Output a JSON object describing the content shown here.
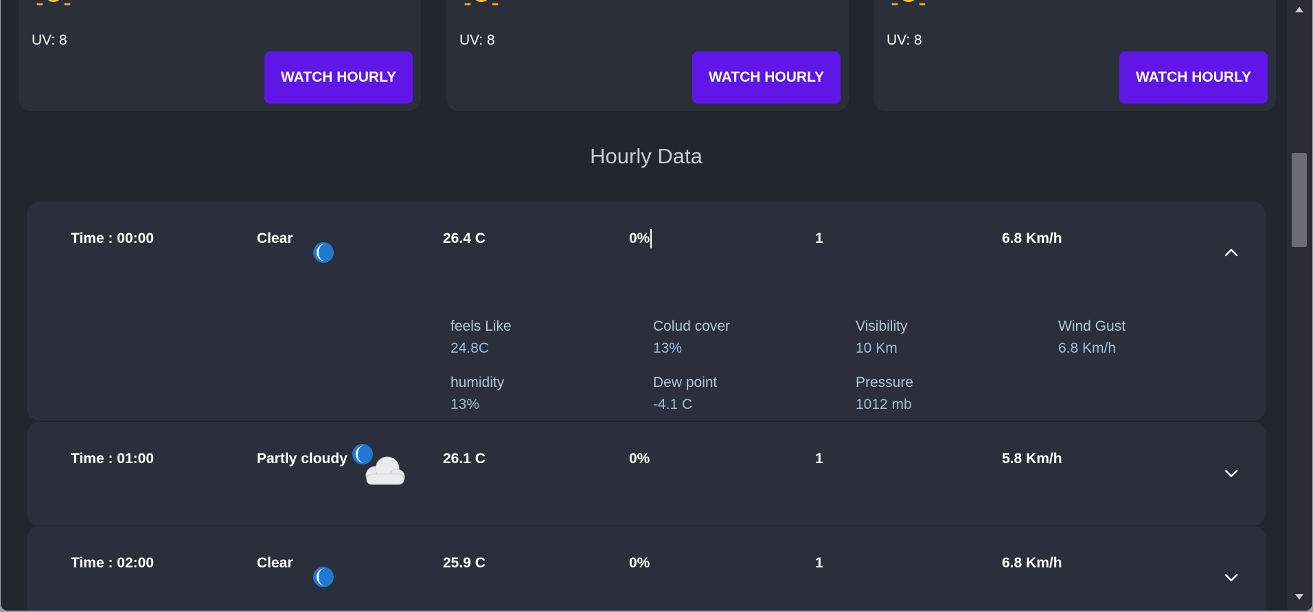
{
  "day_cards": [
    {
      "uv_label": "UV: 8",
      "button_label": "WATCH HOURLY",
      "icon": "sun-icon"
    },
    {
      "uv_label": "UV: 8",
      "button_label": "WATCH HOURLY",
      "icon": "sun-icon"
    },
    {
      "uv_label": "UV: 8",
      "button_label": "WATCH HOURLY",
      "icon": "sun-icon"
    }
  ],
  "section_title": "Hourly Data",
  "hours": [
    {
      "time": "Time : 00:00",
      "condition": "Clear",
      "icon": "moon-icon",
      "temp": "26.4 C",
      "rain": "0%",
      "uv": "1",
      "wind": "6.8 Km/h",
      "expanded": true,
      "details": [
        {
          "label": "feels Like",
          "value": "24.8C"
        },
        {
          "label": "Colud cover",
          "value": "13%"
        },
        {
          "label": "Visibility",
          "value": "10 Km"
        },
        {
          "label": "Wind Gust",
          "value": "6.8 Km/h"
        },
        {
          "label": "humidity",
          "value": "13%"
        },
        {
          "label": "Dew point",
          "value": "-4.1 C"
        },
        {
          "label": "Pressure",
          "value": "1012 mb"
        }
      ]
    },
    {
      "time": "Time : 01:00",
      "condition": "Partly cloudy",
      "icon": "moon-cloud-icon",
      "temp": "26.1 C",
      "rain": "0%",
      "uv": "1",
      "wind": "5.8 Km/h",
      "expanded": false
    },
    {
      "time": "Time : 02:00",
      "condition": "Clear",
      "icon": "moon-icon",
      "temp": "25.9 C",
      "rain": "0%",
      "uv": "1",
      "wind": "6.8 Km/h",
      "expanded": false
    }
  ],
  "colors": {
    "page_background": "#22262e",
    "card_background": "#2a2f3a",
    "accent_button": "#5f16e6",
    "detail_text": "#a3bbd9"
  }
}
